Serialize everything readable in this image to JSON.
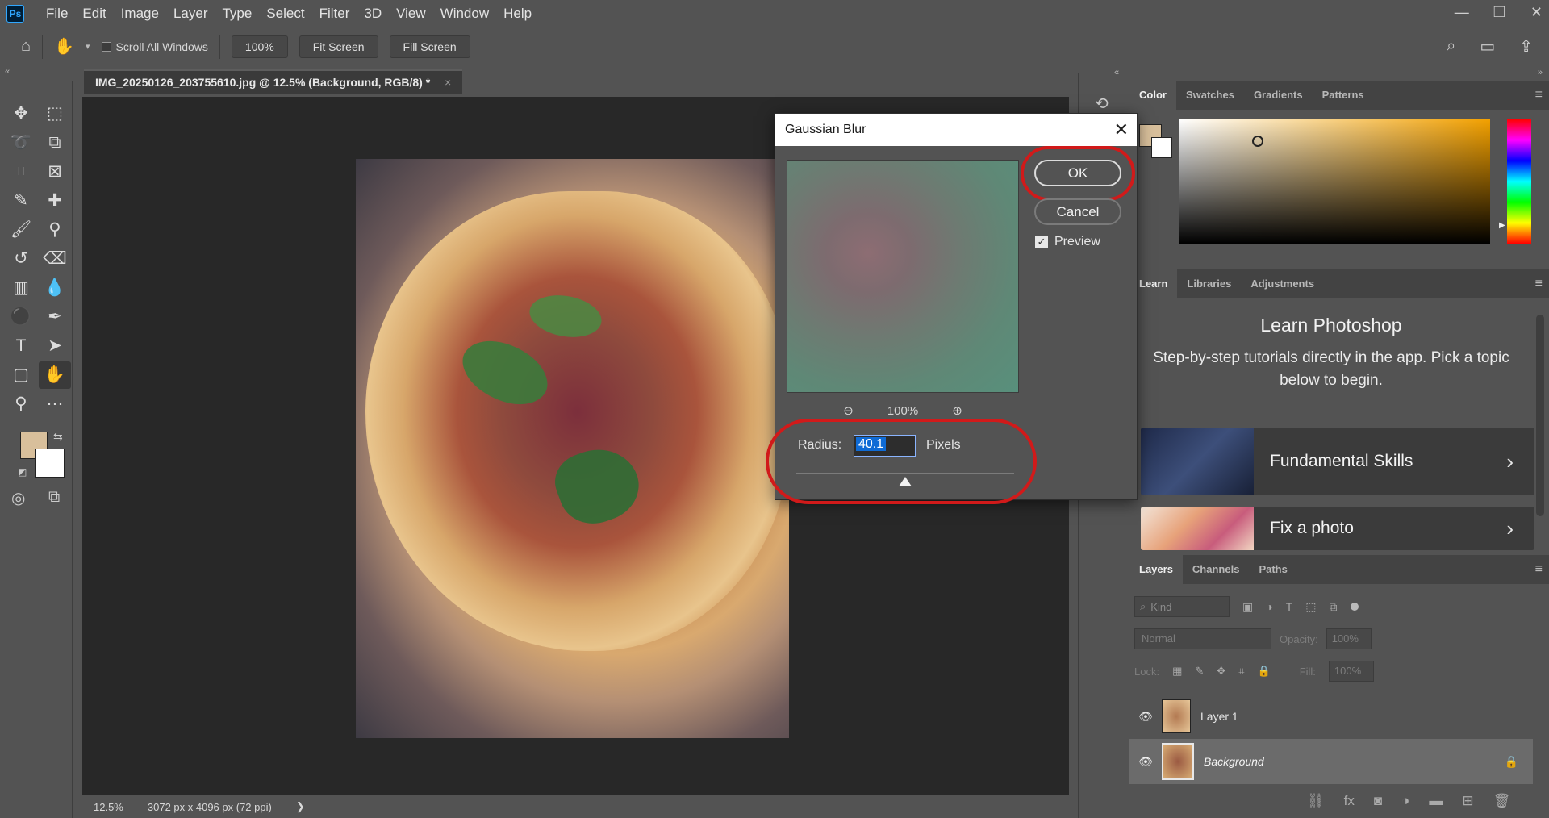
{
  "app": {
    "logo": "Ps"
  },
  "menu": [
    "File",
    "Edit",
    "Image",
    "Layer",
    "Type",
    "Select",
    "Filter",
    "3D",
    "View",
    "Window",
    "Help"
  ],
  "options_bar": {
    "scroll_all_windows": "Scroll All Windows",
    "zoom_button": "100%",
    "fit_screen": "Fit Screen",
    "fill_screen": "Fill Screen"
  },
  "document": {
    "tab_title": "IMG_20250126_203755610.jpg @ 12.5% (Background, RGB/8) *",
    "close_glyph": "×"
  },
  "status": {
    "zoom": "12.5%",
    "dimensions": "3072 px x 4096 px (72 ppi)",
    "arrow": "❯"
  },
  "dialog": {
    "title": "Gaussian Blur",
    "ok": "OK",
    "cancel": "Cancel",
    "preview_label": "Preview",
    "preview_checked": true,
    "zoom_level": "100%",
    "radius_label": "Radius:",
    "radius_value": "40.1",
    "radius_unit": "Pixels"
  },
  "color_panel": {
    "tabs": [
      "Color",
      "Swatches",
      "Gradients",
      "Patterns"
    ],
    "active_tab": "Color",
    "foreground": "#d8bf9b",
    "background": "#ffffff"
  },
  "learn_panel": {
    "tabs": [
      "Learn",
      "Libraries",
      "Adjustments"
    ],
    "active_tab": "Learn",
    "heading": "Learn Photoshop",
    "description": "Step-by-step tutorials directly in the app. Pick a topic below to begin.",
    "cards": [
      "Fundamental Skills",
      "Fix a photo"
    ]
  },
  "layers_panel": {
    "tabs": [
      "Layers",
      "Channels",
      "Paths"
    ],
    "active_tab": "Layers",
    "search_placeholder": "Kind",
    "blend_mode": "Normal",
    "opacity_label": "Opacity:",
    "opacity_value": "100%",
    "lock_label": "Lock:",
    "fill_label": "Fill:",
    "fill_value": "100%",
    "layers": [
      {
        "name": "Layer 1",
        "visible": true,
        "selected": false
      },
      {
        "name": "Background",
        "visible": true,
        "selected": true,
        "locked": true
      }
    ]
  },
  "colors": {
    "highlight_red": "#d11a1a",
    "selection_blue": "#0f6bd5",
    "ps_blue": "#31a8ff"
  }
}
